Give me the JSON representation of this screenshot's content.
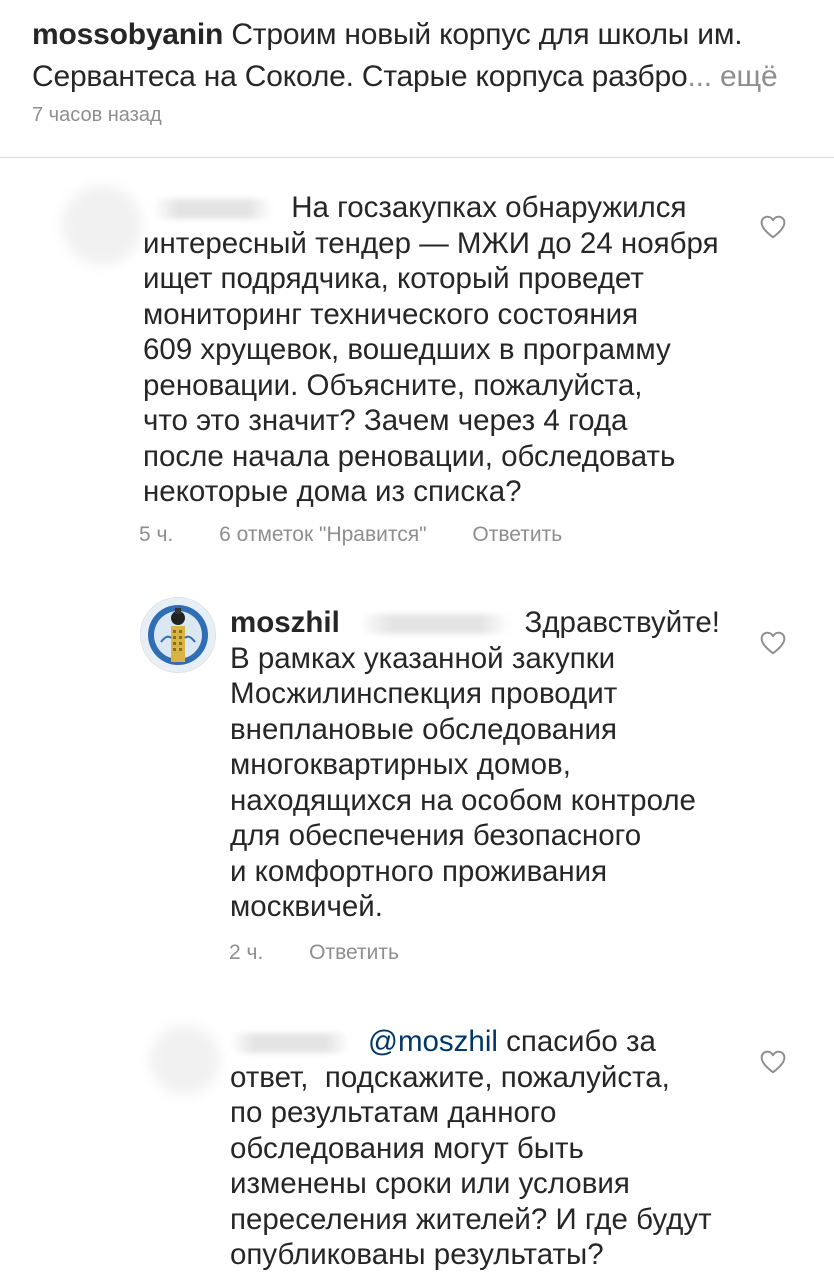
{
  "post": {
    "author": "mossobyanin",
    "caption": "Строим новый корпус для школы им. Сервантеса на Соколе. Старые корпуса разбро",
    "more_label": "... ещё",
    "time": "7 часов назад"
  },
  "comments": [
    {
      "text_lines": [
        "На госзакупках обнаружился",
        "интересный тендер — МЖИ до 24 ноября",
        "ищет подрядчика, который проведет",
        "мониторинг технического состояния",
        "609 хрущевок, вошедших в программу",
        "реновации. Объясните, пожалуйста,",
        "что это значит? Зачем через 4 года",
        "после начала реновации, обследовать",
        "некоторые дома из списка?"
      ],
      "time": "5 ч.",
      "likes": "6 отметок \"Нравится\"",
      "reply_label": "Ответить"
    },
    {
      "author": "moszhil",
      "first_line": "Здравствуйте!",
      "text_lines": [
        "В рамках указанной закупки",
        "Мосжилинспекция проводит",
        "внеплановые обследования",
        "многоквартирных домов,",
        "находящихся на особом контроле",
        "для обеспечения безопасного",
        "и комфортного проживания",
        "москвичей."
      ],
      "time": "2 ч.",
      "reply_label": "Ответить"
    },
    {
      "mention": "@moszhil",
      "first_line": "спасибо за",
      "text_lines": [
        "ответ,  подскажите, пожалуйста,",
        "по результатам данного",
        "обследования могут быть",
        "изменены сроки или условия",
        "переселения жителей? И где будут",
        "опубликованы результаты?"
      ]
    }
  ],
  "colors": {
    "text": "#262626",
    "secondary": "#8e8e8e",
    "mention": "#00376b",
    "divider": "#dbdbdb"
  },
  "icons": {
    "like": "heart-outline-icon"
  }
}
